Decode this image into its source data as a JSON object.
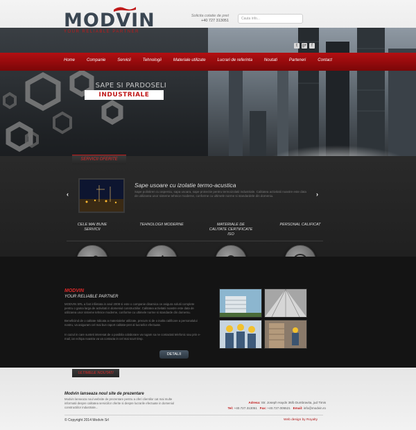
{
  "header": {
    "logo_text": "MODVIN",
    "logo_tagline": "YOUR RELIABLE PARTNER",
    "quote_label": "Solicita cotatie de pret",
    "quote_phone": "+40 727 313051",
    "search_placeholder": "Cauta info...",
    "social": [
      "t",
      "g+",
      "f"
    ]
  },
  "nav": {
    "items": [
      "Home",
      "Companie",
      "Servicii",
      "Tehnologii",
      "Materiale utilizate",
      "Lucrari de referinta",
      "Noutati",
      "Parteneri",
      "Contact"
    ]
  },
  "hero": {
    "line1": "SAPE SI PARDOSELI",
    "line2": "INDUSTRIALE"
  },
  "services": {
    "tab_label": "SERVICII OFERITE",
    "prev_arrow": "‹",
    "next_arrow": "›",
    "title": "Sape usoare cu izolatie termo-acustica",
    "text": "Sape polistiren cu aspersiu, sapa usoara, sape protectie pentru termoizolatii industriale. Calitatea activitatii noastre este data de utilizarea unor sisteme tehnice moderne, conforme cu ultimele norme si standardele din domeniu."
  },
  "features": [
    {
      "label": "CELE MAI BUNE SERVICII",
      "icon": "gears-icon"
    },
    {
      "label": "TEHNOLOGII MODERNE",
      "icon": "thumbs-up-icon"
    },
    {
      "label": "MATERIALE DE CALITATE CERTIFICATE ISO",
      "icon": "award-ribbon-icon"
    },
    {
      "label": "PERSONAL CALIFICAT",
      "icon": "user-icon"
    }
  ],
  "about": {
    "heading": "MODVIN",
    "subheading": "YOUR RELIABLE PARTNER",
    "p1": "MODVIN SRL a fost infiintata in anul 2008 si este o companie dinamica ce asigura solutii complete pentru o gama larga de activitati in domeniul constructiilor. Calitatea activitatii noastre este data de utilizarea unor sisteme tehnice moderne, conforme cu ultimele norme si standarde din domeniu.",
    "p2": "Beneficiind de o calitate ridicata a materialelor utilizate, precum si de o inalta calificare a personalului nostru, va asiguram cel mai bun raport calitate-pret al lucrarilor efectuate.",
    "p3": "In cazul in care sunteti interesat de o posibila colaborare va rugam sa ne contactati telefonic sau prin e-mail, iar echipa noastra va va contacta in cel mai scurt timp.",
    "details_label": "DETALII"
  },
  "news": {
    "tab_label": "ULTIMELE NOUTATI",
    "title": "Modvin lanseaza noul site de prezentare",
    "text": "Modvin lanseaza noul website de prezentare pentru a oferi clientilor cat mai multe informatii despre calitatea serviciilor oferite si despre lucrarile efectuate in domeniul constructiilor industriale..."
  },
  "contact": {
    "address_label": "Adresa:",
    "address": "Str. Joseph Haydn 36/b Dumbravita, jud Timis",
    "tel_label": "Tel:",
    "tel": "+40.727.313051",
    "fax_label": "Fax:",
    "fax": "+40.727.005521",
    "email_label": "Email:",
    "email": "info@modvin.ro"
  },
  "footer": {
    "copyright": "© Copyright 2014 Modvin Srl",
    "webdesign": "Web design by Royalty"
  },
  "colors": {
    "accent_red": "#c01a1a",
    "dark": "#1a1a1a",
    "steel": "#3a4652"
  }
}
